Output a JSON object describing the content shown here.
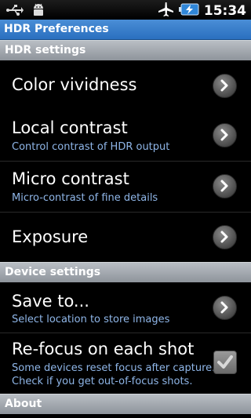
{
  "status_bar": {
    "time": "15:34",
    "icons": [
      "usb-icon",
      "android-debug-icon",
      "airplane-mode-icon",
      "battery-charging-icon"
    ]
  },
  "app_title": "HDR Preferences",
  "sections": {
    "hdr_settings": "HDR settings",
    "device_settings": "Device settings",
    "about": "About"
  },
  "items": {
    "color_vividness": {
      "title": "Color vividness"
    },
    "local_contrast": {
      "title": "Local contrast",
      "summary": "Control contrast of HDR output"
    },
    "micro_contrast": {
      "title": "Micro contrast",
      "summary": "Micro-contrast of fine details"
    },
    "exposure": {
      "title": "Exposure"
    },
    "save_to": {
      "title": "Save to...",
      "summary": "Select location to store images"
    },
    "refocus": {
      "title": "Re-focus on each shot",
      "summary_line1": "Some devices reset focus after capture.",
      "summary_line2": "Check if you get out-of-focus shots.",
      "checked": true
    }
  },
  "colors": {
    "title_bar": "#2a6fbf",
    "section_header": "#9aa0a6",
    "summary_text": "#8fb6e8"
  }
}
